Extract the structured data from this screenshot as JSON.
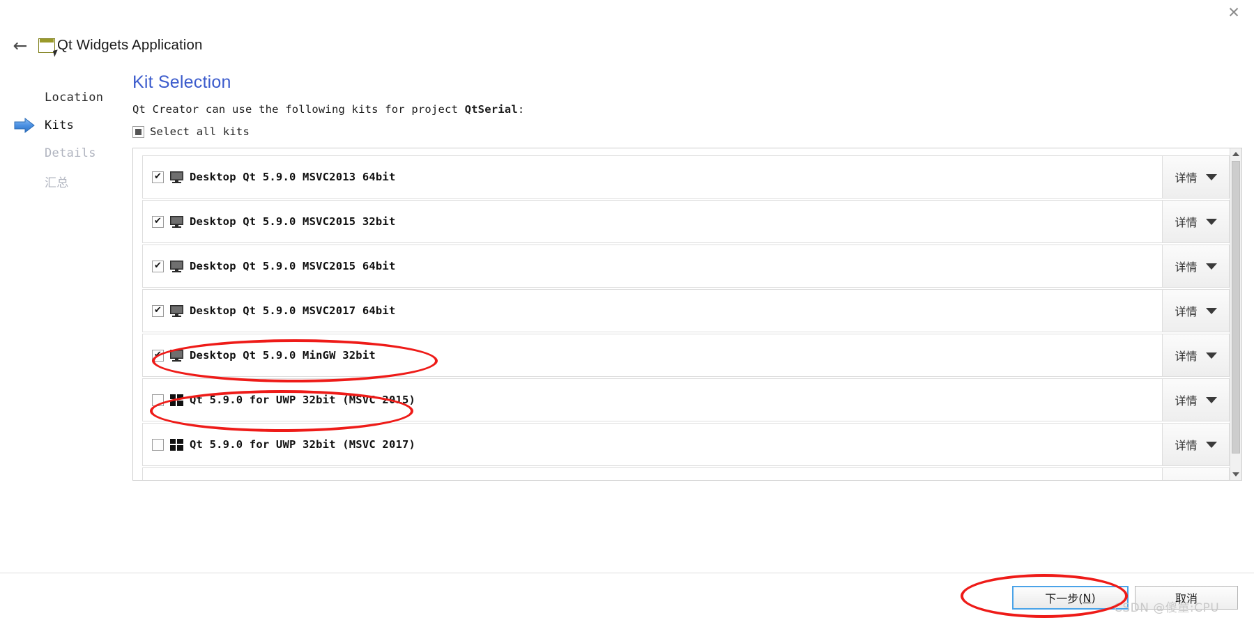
{
  "window": {
    "close_icon": "close-icon",
    "back_icon": "back-arrow-icon",
    "app_icon": "qt-widgets-app-icon",
    "title": "Qt Widgets Application"
  },
  "sidebar": {
    "items": [
      {
        "label": "Location",
        "state": "done",
        "current": false
      },
      {
        "label": "Kits",
        "state": "active",
        "current": true
      },
      {
        "label": "Details",
        "state": "todo",
        "current": false
      },
      {
        "label": "汇总",
        "state": "todo",
        "current": false
      }
    ],
    "current_arrow_icon": "right-arrow-icon"
  },
  "main": {
    "page_title": "Kit Selection",
    "subtitle_prefix": "Qt Creator can use the following kits for project ",
    "project_name": "QtSerial",
    "subtitle_suffix": ":",
    "select_all": {
      "label": "Select all kits",
      "state": "partial"
    },
    "details_button_label": "详情",
    "caret_icon": "chevron-down-icon",
    "kits": [
      {
        "label": "Desktop Qt 5.9.0 MSVC2013 64bit",
        "checked": true,
        "icon": "monitor-icon"
      },
      {
        "label": "Desktop Qt 5.9.0 MSVC2015 32bit",
        "checked": true,
        "icon": "monitor-icon"
      },
      {
        "label": "Desktop Qt 5.9.0 MSVC2015 64bit",
        "checked": true,
        "icon": "monitor-icon"
      },
      {
        "label": "Desktop Qt 5.9.0 MSVC2017 64bit",
        "checked": true,
        "icon": "monitor-icon"
      },
      {
        "label": "Desktop Qt 5.9.0 MinGW 32bit",
        "checked": true,
        "icon": "monitor-icon"
      },
      {
        "label": "Qt 5.9.0 for UWP 32bit (MSVC 2015)",
        "checked": false,
        "icon": "windows-logo-icon"
      },
      {
        "label": "Qt 5.9.0 for UWP 32bit (MSVC 2017)",
        "checked": false,
        "icon": "windows-logo-icon"
      },
      {
        "label": "",
        "checked": false,
        "icon": "monitor-icon"
      }
    ],
    "scrollbar": {
      "up_icon": "scroll-up-arrow-icon",
      "down_icon": "scroll-down-arrow-icon"
    }
  },
  "footer": {
    "next_text": "下一步(",
    "next_mnemonic": "N",
    "next_text_end": ")",
    "cancel_label": "取消"
  },
  "watermark": {
    "text": "CSDN @傻童:CPU"
  },
  "colors": {
    "accent": "#3b5bcc",
    "primary_button_border": "#4aa3e8",
    "annotation": "#ee1b18",
    "todo_text": "#b0b4bf"
  }
}
